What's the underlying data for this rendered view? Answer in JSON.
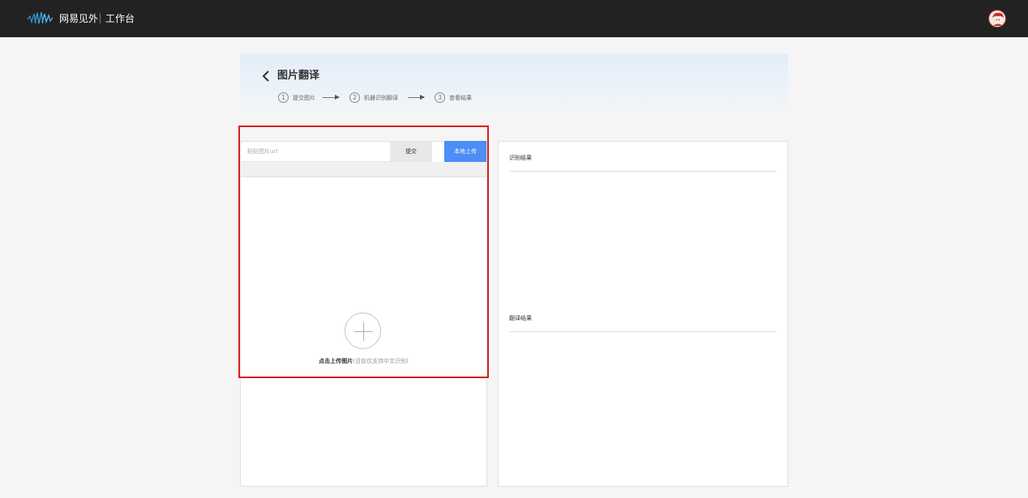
{
  "topbar": {
    "brand_name": "网易见外",
    "brand_sub": "工作台",
    "logo_icon": "wave-logo-icon",
    "avatar_icon": "user-avatar-icon"
  },
  "header": {
    "back_icon": "chevron-left-icon",
    "title": "图片翻译",
    "steps": [
      {
        "num": "1",
        "label": "提交图片"
      },
      {
        "num": "2",
        "label": "机器识别翻译"
      },
      {
        "num": "3",
        "label": "查看结果"
      }
    ]
  },
  "upload": {
    "url_placeholder": "粘贴图片url",
    "url_value": "",
    "submit_label": "提交",
    "local_upload_label": "本地上传",
    "plus_icon": "plus-icon",
    "hint_strong": "点击上传图片",
    "hint_muted": "(目前仅支持中文识别)"
  },
  "results": {
    "recognition_label": "识别结果",
    "translation_label": "翻译结果"
  },
  "colors": {
    "topbar_bg": "#222222",
    "page_bg": "#f5f5f5",
    "accent_blue": "#4c8ef5",
    "highlight_red": "#d62020"
  }
}
